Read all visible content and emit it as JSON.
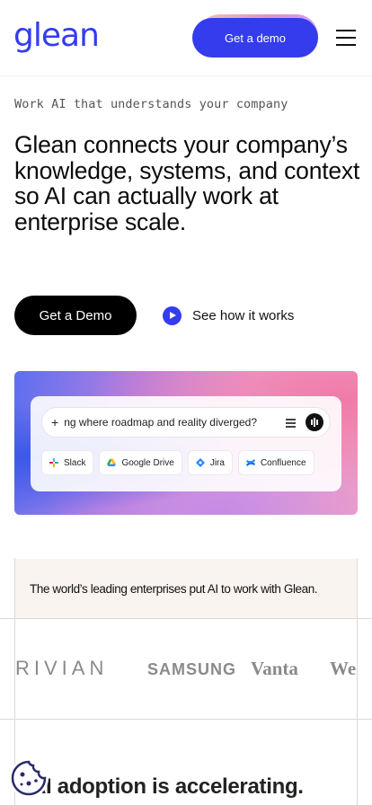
{
  "header": {
    "logo": "glean",
    "cta_label": "Get a demo",
    "menu_icon": "hamburger-icon"
  },
  "hero": {
    "eyebrow": "Work AI that understands your company",
    "headline": "Glean connects your company’s knowledge, systems, and context so AI can actually work at enterprise scale.",
    "primary_cta": "Get a Demo",
    "secondary_cta": "See how it works"
  },
  "visual": {
    "search_prefix": "+",
    "search_query": "ng where roadmap and reality diverged?",
    "chips": [
      {
        "label": "Slack",
        "icon": "slack-icon"
      },
      {
        "label": "Google Drive",
        "icon": "google-drive-icon"
      },
      {
        "label": "Jira",
        "icon": "jira-icon"
      },
      {
        "label": "Confluence",
        "icon": "confluence-icon"
      }
    ]
  },
  "logos_section": {
    "lead": "The world’s leading enterprises put AI to work with Glean.",
    "brands": [
      "RIVIAN",
      "SAMSUNG",
      "Vanta",
      "We"
    ]
  },
  "next_section": {
    "heading": "AI adoption is accelerating."
  },
  "colors": {
    "brand": "#343ced",
    "black": "#000000",
    "lead_bg": "#faf4f0"
  }
}
